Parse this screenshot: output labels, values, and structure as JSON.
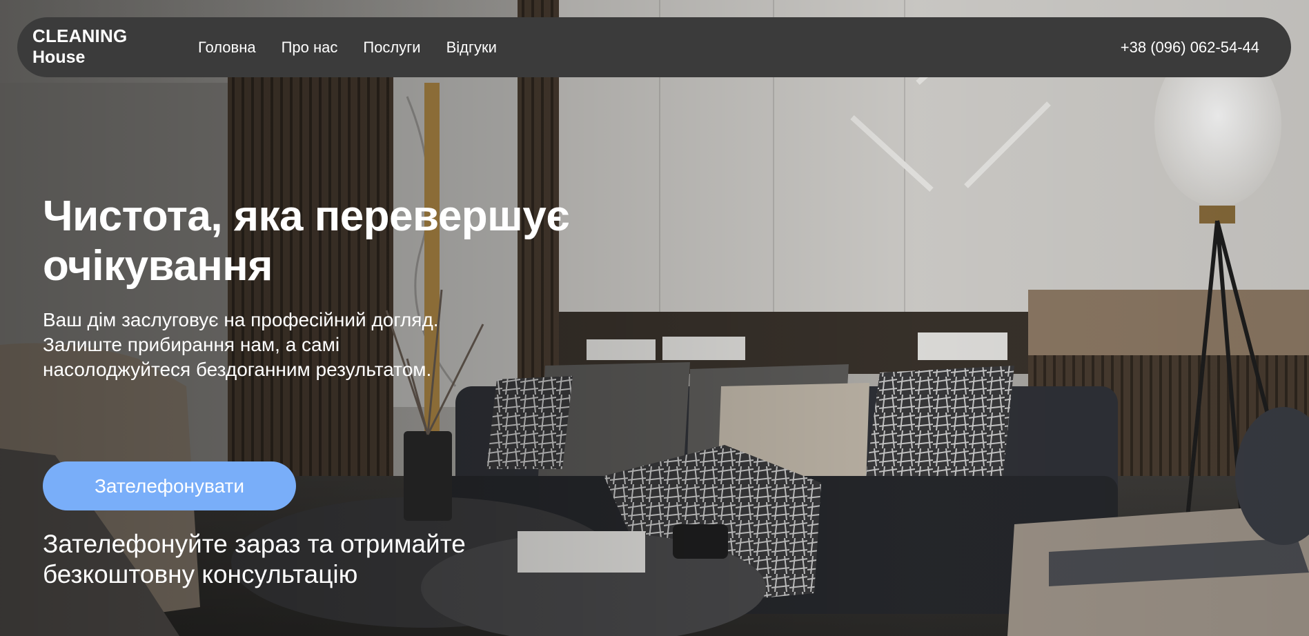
{
  "brand": {
    "line1": "CLEANING",
    "line2": "House"
  },
  "nav": {
    "items": [
      {
        "label": "Головна"
      },
      {
        "label": "Про нас"
      },
      {
        "label": "Послуги"
      },
      {
        "label": "Відгуки"
      }
    ],
    "phone": "+38 (096) 062-54-44"
  },
  "hero": {
    "headline": "Чистота, яка перевершує очікування",
    "lead": "Ваш дім заслуговує на професійний догляд. Залиште прибирання нам, а самі насолоджуйтеся бездоганним результатом.",
    "cta_label": "Зателефонувати",
    "cta_note": "Зателефонуйте зараз та отримайте безкоштовну консультацію"
  },
  "colors": {
    "navbar_bg": "#3b3b3b",
    "cta_bg": "#79aef9",
    "text": "#ffffff"
  }
}
